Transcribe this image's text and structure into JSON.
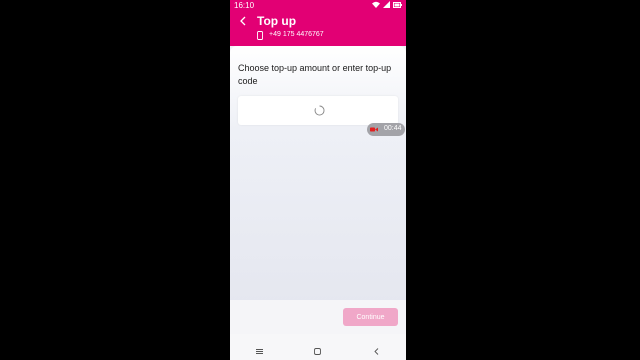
{
  "status_bar": {
    "time": "16:10",
    "battery_icon": "battery-icon",
    "wifi_icon": "wifi-icon"
  },
  "header": {
    "title": "Top up",
    "phone_number": "+49 175 4476767"
  },
  "main": {
    "prompt": "Choose top-up amount or enter top-up code"
  },
  "recording": {
    "time": "00:44"
  },
  "footer": {
    "continue_label": "Continue"
  },
  "colors": {
    "brand": "#e20074",
    "button_disabled": "#f0a7c8"
  }
}
